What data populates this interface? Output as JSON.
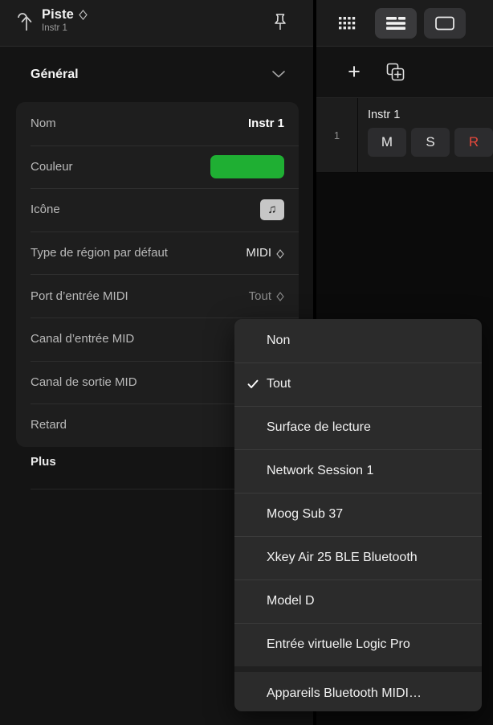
{
  "inspector": {
    "header": {
      "back_icon": "arrow-up-hook-icon",
      "title": "Piste",
      "subtitle": "Instr 1",
      "chevron_icon": "diamond-chevron-icon",
      "pin_icon": "pushpin-icon"
    },
    "section": {
      "title": "Général",
      "collapse_icon": "chevron-down-icon"
    },
    "rows": [
      {
        "label": "Nom",
        "value": "Instr 1",
        "type": "text"
      },
      {
        "label": "Couleur",
        "value": "",
        "type": "color",
        "color": "#1faf33"
      },
      {
        "label": "Icône",
        "value": "♫",
        "type": "icon"
      },
      {
        "label": "Type de région par défaut",
        "value": "MIDI",
        "type": "popup"
      },
      {
        "label": "Port d’entrée MIDI",
        "value": "Tout",
        "type": "popup",
        "dim": true
      },
      {
        "label": "Canal d’entrée MID",
        "value": "",
        "type": "text"
      },
      {
        "label": "Canal de sortie MID",
        "value": "",
        "type": "text"
      },
      {
        "label": "Retard",
        "value": "",
        "type": "field"
      }
    ],
    "more_section": {
      "title": "Plus"
    }
  },
  "toolbar": {
    "buttons": [
      {
        "name": "library-grid-button",
        "icon": "grid-dots-icon",
        "active": false
      },
      {
        "name": "inspector-button",
        "icon": "list-lines-icon",
        "active": true
      },
      {
        "name": "view-window-button",
        "icon": "screen-rect-icon",
        "active": false
      }
    ]
  },
  "track_toolbar": {
    "add_track_label": "+",
    "add_track_icon": "plus-icon",
    "duplicate_track_icon": "duplicate-track-icon"
  },
  "track_list": {
    "tracks": [
      {
        "number": "1",
        "name": "Instr 1",
        "buttons": [
          {
            "label": "M",
            "name": "mute-button"
          },
          {
            "label": "S",
            "name": "solo-button"
          },
          {
            "label": "R",
            "name": "record-enable-button"
          }
        ]
      }
    ]
  },
  "menu": {
    "name": "midi-input-port-menu",
    "check_icon": "checkmark-icon",
    "items": [
      {
        "label": "Non",
        "checked": false,
        "separator_before": false
      },
      {
        "label": "Tout",
        "checked": true,
        "separator_before": false
      },
      {
        "label": "Surface de lecture",
        "checked": false,
        "separator_before": false
      },
      {
        "label": "Network Session 1",
        "checked": false,
        "separator_before": false
      },
      {
        "label": "Moog Sub 37",
        "checked": false,
        "separator_before": false
      },
      {
        "label": "Xkey Air 25 BLE Bluetooth",
        "checked": false,
        "separator_before": false
      },
      {
        "label": "Model D",
        "checked": false,
        "separator_before": false
      },
      {
        "label": "Entrée virtuelle Logic Pro",
        "checked": false,
        "separator_before": false
      },
      {
        "label": "Appareils Bluetooth MIDI…",
        "checked": false,
        "separator_before": true
      }
    ]
  },
  "colors": {
    "accent_green": "#1faf33",
    "record_red": "#e8493c",
    "panel_bg": "#141414",
    "card_bg": "#1e1e1e",
    "menu_bg": "#2b2b2b"
  }
}
